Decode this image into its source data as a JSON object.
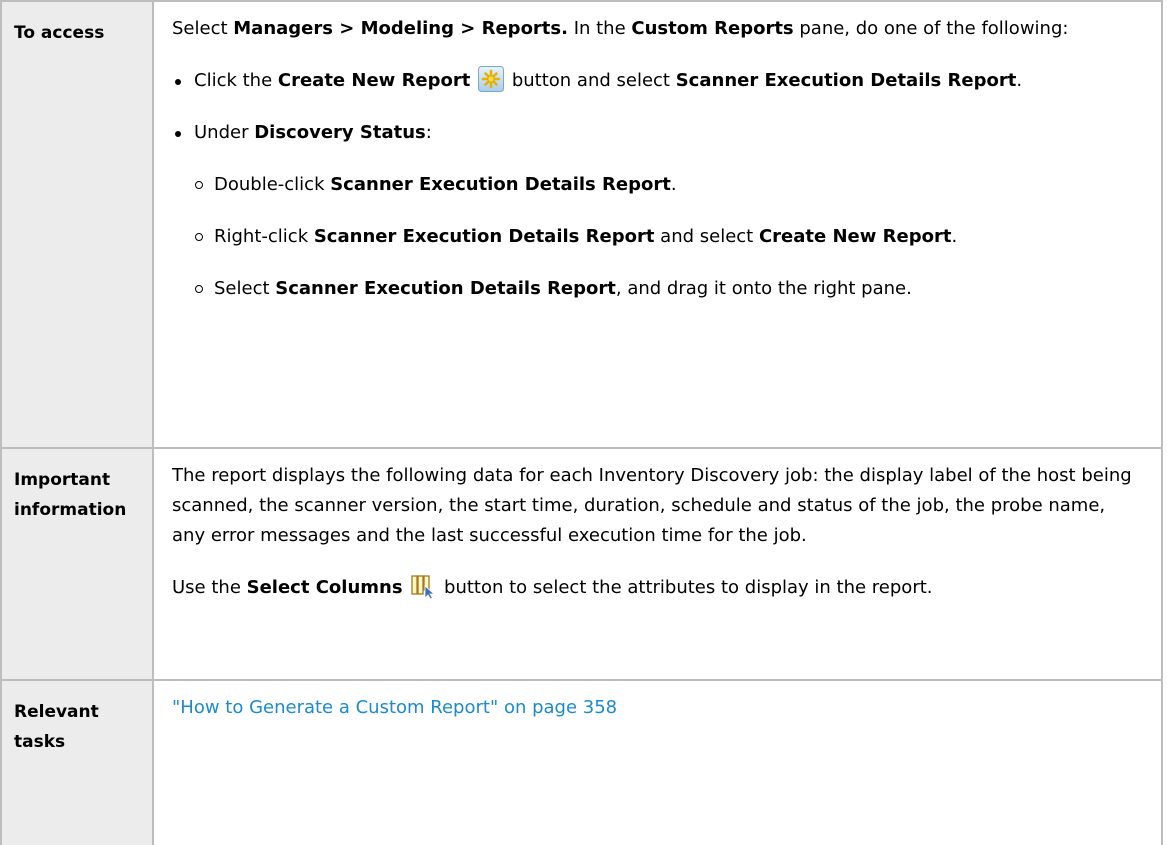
{
  "rows": {
    "access": {
      "header": "To access",
      "intro": {
        "t1": "Select ",
        "b1": "Managers > Modeling > Reports.",
        "t2": " In the ",
        "b2": "Custom Reports",
        "t3": " pane, do one of the following:"
      },
      "bullet1": {
        "t1": "Click the ",
        "b1": "Create New Report",
        "t2": " button and select ",
        "b2": "Scanner Execution Details Report",
        "t3": "."
      },
      "bullet2": {
        "t1": "Under ",
        "b1": "Discovery Status",
        "t2": ":"
      },
      "sub1": {
        "t1": "Double-click ",
        "b1": "Scanner Execution Details Report",
        "t2": "."
      },
      "sub2": {
        "t1": "Right-click ",
        "b1": "Scanner Execution Details Report",
        "t2": " and select ",
        "b2": "Create New Report",
        "t3": "."
      },
      "sub3": {
        "t1": "Select ",
        "b1": "Scanner Execution Details Report",
        "t2": ", and drag it onto the right pane."
      }
    },
    "important": {
      "header_line1": "Important",
      "header_line2": "information",
      "para1": "The report displays the following data for each Inventory Discovery job: the display label of the host being scanned, the scanner version, the start time, duration, schedule and status of the job, the probe name, any error messages and the last successful execution time for the job.",
      "para2": {
        "t1": "Use the ",
        "b1": "Select Columns",
        "t2": " button to select the attributes to display in the report."
      }
    },
    "tasks": {
      "header_line1": "Relevant",
      "header_line2": "tasks",
      "link": "\"How to Generate a Custom Report\" on page 358"
    }
  },
  "icons": {
    "create_new_report": "create-new-report-icon",
    "select_columns": "select-columns-icon"
  },
  "colors": {
    "header_bg": "#ececec",
    "border": "#bdbdbd",
    "link": "#1a8bd1"
  }
}
